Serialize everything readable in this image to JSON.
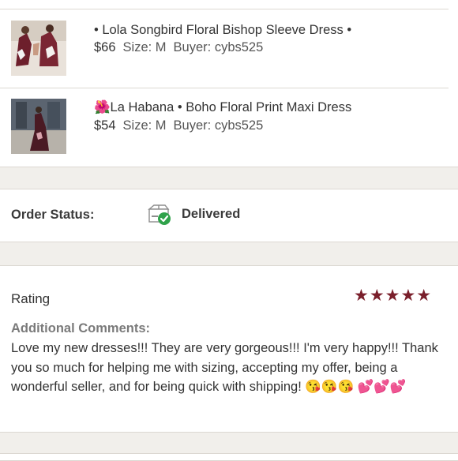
{
  "order_items": [
    {
      "title": "• Lola Songbird Floral Bishop Sleeve Dress •",
      "price": "$66",
      "size": "Size: M",
      "buyer": "Buyer: cybs525",
      "thumbnail_icon": "dress-photo"
    },
    {
      "title": "🌺La Habana • Boho Floral Print Maxi Dress",
      "price": "$54",
      "size": "Size: M",
      "buyer": "Buyer: cybs525",
      "thumbnail_icon": "dress-photo"
    }
  ],
  "order_status": {
    "label": "Order Status:",
    "value": "Delivered",
    "icon": "package-delivered-icon",
    "check_color": "#2fa24a"
  },
  "rating": {
    "label": "Rating",
    "stars": "★★★★★",
    "star_count": 5,
    "star_color": "#7a1f2b"
  },
  "comments": {
    "label": "Additional Comments:",
    "text": "Love my new dresses!!! They are very gorgeous!!! I'm very happy!!! Thank you so much for helping me with sizing, accepting my offer, being a wonderful seller, and for being quick with shipping! 😘😘😘 💕💕💕"
  }
}
